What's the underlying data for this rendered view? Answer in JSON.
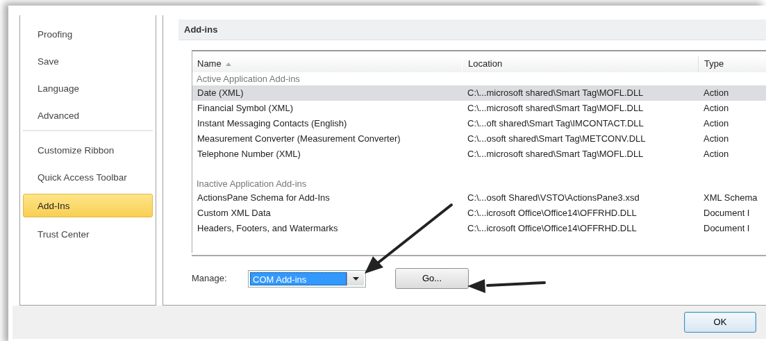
{
  "sidebar": {
    "items": [
      {
        "label": "Proofing",
        "selected": false,
        "divider_after": false
      },
      {
        "label": "Save",
        "selected": false,
        "divider_after": false
      },
      {
        "label": "Language",
        "selected": false,
        "divider_after": false
      },
      {
        "label": "Advanced",
        "selected": false,
        "divider_after": true
      },
      {
        "label": "Customize Ribbon",
        "selected": false,
        "divider_after": false
      },
      {
        "label": "Quick Access Toolbar",
        "selected": false,
        "divider_after": false
      },
      {
        "label": "Add-Ins",
        "selected": true,
        "divider_after": false
      },
      {
        "label": "Trust Center",
        "selected": false,
        "divider_after": false
      }
    ]
  },
  "section_title": "Add-ins",
  "table": {
    "columns": [
      {
        "label": "Name",
        "sort_ascending": true
      },
      {
        "label": "Location"
      },
      {
        "label": "Type"
      }
    ],
    "groups": [
      {
        "heading": "Active Application Add-ins",
        "rows": [
          {
            "cells": [
              "Date (XML)",
              "C:\\...microsoft shared\\Smart Tag\\MOFL.DLL",
              "Action"
            ],
            "selected": true
          },
          {
            "cells": [
              "Financial Symbol (XML)",
              "C:\\...microsoft shared\\Smart Tag\\MOFL.DLL",
              "Action"
            ],
            "selected": false
          },
          {
            "cells": [
              "Instant Messaging Contacts (English)",
              "C:\\...oft shared\\Smart Tag\\IMCONTACT.DLL",
              "Action"
            ],
            "selected": false
          },
          {
            "cells": [
              "Measurement Converter (Measurement Converter)",
              "C:\\...osoft shared\\Smart Tag\\METCONV.DLL",
              "Action"
            ],
            "selected": false
          },
          {
            "cells": [
              "Telephone Number (XML)",
              "C:\\...microsoft shared\\Smart Tag\\MOFL.DLL",
              "Action"
            ],
            "selected": false
          }
        ]
      },
      {
        "heading": "Inactive Application Add-ins",
        "rows": [
          {
            "cells": [
              "ActionsPane Schema for Add-Ins",
              "C:\\...osoft Shared\\VSTO\\ActionsPane3.xsd",
              "XML Schema"
            ],
            "selected": false
          },
          {
            "cells": [
              "Custom XML Data",
              "C:\\...icrosoft Office\\Office14\\OFFRHD.DLL",
              "Document I"
            ],
            "selected": false
          },
          {
            "cells": [
              "Headers, Footers, and Watermarks",
              "C:\\...icrosoft Office\\Office14\\OFFRHD.DLL",
              "Document I"
            ],
            "selected": false
          }
        ]
      }
    ]
  },
  "manage": {
    "label": "Manage:",
    "value": "COM Add-ins",
    "go_button": {
      "label": "Go..."
    }
  },
  "buttons": [
    {
      "label": "OK"
    }
  ]
}
